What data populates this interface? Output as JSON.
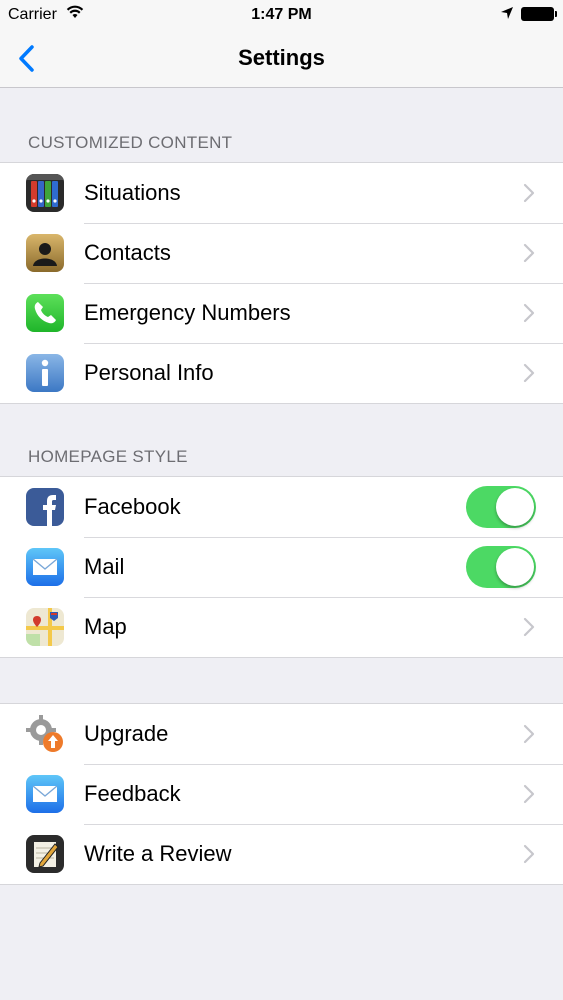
{
  "status_bar": {
    "carrier": "Carrier",
    "time": "1:47 PM"
  },
  "nav": {
    "title": "Settings"
  },
  "sections": {
    "customized": {
      "header": "CUSTOMIZED CONTENT",
      "items": [
        {
          "label": "Situations",
          "icon": "folders-icon"
        },
        {
          "label": "Contacts",
          "icon": "contacts-icon"
        },
        {
          "label": "Emergency Numbers",
          "icon": "phone-icon"
        },
        {
          "label": "Personal Info",
          "icon": "info-icon"
        }
      ]
    },
    "homepage": {
      "header": "HOMEPAGE STYLE",
      "items": [
        {
          "label": "Facebook",
          "icon": "facebook-icon",
          "toggle": true
        },
        {
          "label": "Mail",
          "icon": "mail-icon",
          "toggle": true
        },
        {
          "label": "Map",
          "icon": "map-icon"
        }
      ]
    },
    "other": {
      "items": [
        {
          "label": "Upgrade",
          "icon": "upgrade-icon"
        },
        {
          "label": "Feedback",
          "icon": "mail-icon"
        },
        {
          "label": "Write a Review",
          "icon": "review-icon"
        }
      ]
    }
  },
  "colors": {
    "accent": "#007aff",
    "toggle_on": "#4cd964",
    "background": "#efeff4",
    "section_header": "#6d6d72"
  }
}
